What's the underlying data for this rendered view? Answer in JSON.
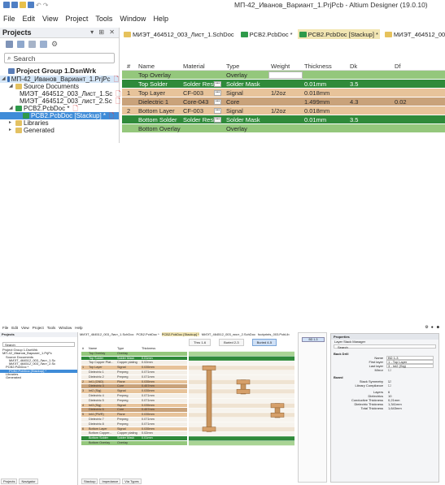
{
  "window": {
    "title": "МП-42_Иванов_Вариант_1.PrjPcb - Altium Designer (19.0.10)"
  },
  "menu": [
    "File",
    "Edit",
    "View",
    "Project",
    "Tools",
    "Window",
    "Help"
  ],
  "projects_panel": {
    "title": "Projects",
    "search_placeholder": "Search",
    "tree": [
      {
        "label": "Project Group 1.DsnWrk",
        "level": 0,
        "kind": "group"
      },
      {
        "label": "МП-42_Иванов_Вариант_1.PrjPc",
        "level": 0,
        "kind": "project",
        "flag": true
      },
      {
        "label": "Source Documents",
        "level": 1,
        "kind": "folder"
      },
      {
        "label": "МИЭТ_464512_003_Лист_1.Sc",
        "level": 2,
        "kind": "sch",
        "flag": true
      },
      {
        "label": "МИЭТ_464512_003_лист_2.Sc",
        "level": 2,
        "kind": "sch",
        "flag": true
      },
      {
        "label": "PCB2.PcbDoc *",
        "level": 1,
        "kind": "pcb",
        "flag": true
      },
      {
        "label": "PCB2.PcbDoc [Stackup] *",
        "level": 2,
        "kind": "pcb-sel",
        "flag": true
      },
      {
        "label": "Libraries",
        "level": 1,
        "kind": "folder"
      },
      {
        "label": "Generated",
        "level": 1,
        "kind": "folder"
      }
    ]
  },
  "doc_tabs": [
    {
      "label": "МИЭТ_464512_003_Лист_1.SchDoc",
      "active": false,
      "color": "#e6c25c"
    },
    {
      "label": "PCB2.PcbDoc *",
      "active": false,
      "color": "#2e9a4a"
    },
    {
      "label": "PCB2.PcbDoc [Stackup] *",
      "active": true,
      "color": "#2e9a4a"
    },
    {
      "label": "МИЭТ_464512_003_лист_2.SchDoc",
      "active": false,
      "color": "#e6c25c"
    },
    {
      "label": "footp",
      "active": false,
      "color": "#8a6c3a"
    }
  ],
  "stackup": {
    "headers": [
      "#",
      "Name",
      "Material",
      "Type",
      "Weight",
      "Thickness",
      "Dk",
      "Df"
    ],
    "rows": [
      {
        "num": "",
        "name": "Top Overlay",
        "material": "",
        "type": "Overlay",
        "weight": "",
        "thickness": "",
        "dk": "",
        "df": "",
        "style": "overlay",
        "combo": false,
        "editing": true
      },
      {
        "num": "",
        "name": "Top Solder",
        "material": "Solder Resist",
        "type": "Solder Mask",
        "weight": "",
        "thickness": "0.01mm",
        "dk": "3.5",
        "df": "",
        "style": "mask",
        "combo": true,
        "editing": false
      },
      {
        "num": "1",
        "name": "Top Layer",
        "material": "CF-003",
        "type": "Signal",
        "weight": "1/2oz",
        "thickness": "0.018mm",
        "dk": "",
        "df": "",
        "style": "copper",
        "combo": true,
        "editing": false
      },
      {
        "num": "",
        "name": "Dielectric 1",
        "material": "Core-043",
        "type": "Core",
        "weight": "",
        "thickness": "1.499mm",
        "dk": "4.3",
        "df": "0.02",
        "style": "core",
        "combo": true,
        "editing": false
      },
      {
        "num": "2",
        "name": "Bottom Layer",
        "material": "CF-003",
        "type": "Signal",
        "weight": "1/2oz",
        "thickness": "0.018mm",
        "dk": "",
        "df": "",
        "style": "copper",
        "combo": true,
        "editing": false
      },
      {
        "num": "",
        "name": "Bottom Solder",
        "material": "Solder Resist",
        "type": "Solder Mask",
        "weight": "",
        "thickness": "0.01mm",
        "dk": "3.5",
        "df": "",
        "style": "mask",
        "combo": true,
        "editing": false
      },
      {
        "num": "",
        "name": "Bottom Overlay",
        "material": "",
        "type": "Overlay",
        "weight": "",
        "thickness": "",
        "dk": "",
        "df": "",
        "style": "overlay",
        "combo": false,
        "editing": false
      }
    ],
    "colors": {
      "overlay": "#94c77c",
      "mask": "#2f8a3a",
      "copper": "#e7c39a",
      "core": "#c9a27a"
    }
  },
  "lower": {
    "menu": [
      "File",
      "Edit",
      "View",
      "Project",
      "Tools",
      "Window",
      "Help"
    ],
    "tabs": [
      "МИЭТ_464512_003_Лист_1.SchDoc",
      "PCB2.PcbDoc *",
      "PCB2.PcbDoc [Stackup] *",
      "МИЭТ_464512_003_лист_2.SchDoc",
      "footprints_003.PcbLib"
    ],
    "projects_title": "Projects",
    "search": "Search",
    "tree": [
      "Project Group 1.DsnWrk",
      "МП-42_Иванов_Вариант_1.PrjPc",
      "Source Documents",
      "МИЭТ_464512_003_Лист_1.Sc",
      "МИЭТ_464512_003_Лист_2.Sc",
      "PCB2.PcbDoc *",
      "PCB2.PcbDoc [Stackup] *",
      "Libraries",
      "Generated"
    ],
    "panel_tabs": [
      "Projects",
      "Navigator"
    ],
    "editor_tabs": [
      "Stackup",
      "Impedance",
      "Via Types"
    ],
    "via_tabs": [
      "Thru 1-6",
      "Buried 2-3",
      "Buried 4-5"
    ],
    "strip_cell": "BD 1-3",
    "table_headers": [
      "#",
      "Name",
      "Type",
      "Thickness"
    ],
    "table_rows": [
      {
        "num": "",
        "name": "Top Overlay",
        "type": "Overlay",
        "thickness": "",
        "style": "overlay"
      },
      {
        "num": "",
        "name": "Top Solder",
        "type": "Solder Mask",
        "thickness": "0.01mm",
        "style": "mask"
      },
      {
        "num": "",
        "name": "Top Copper Plat...",
        "type": "Copper plating",
        "thickness": "0.02mm",
        "style": "plain"
      },
      {
        "num": "1",
        "name": "Top Layer",
        "type": "Signal",
        "thickness": "0.035mm",
        "style": "copper"
      },
      {
        "num": "",
        "name": "Dielectric 1",
        "type": "Prepreg",
        "thickness": "0.071mm",
        "style": "plain"
      },
      {
        "num": "",
        "name": "Dielectric 2",
        "type": "Prepreg",
        "thickness": "0.071mm",
        "style": "plain"
      },
      {
        "num": "2",
        "name": "Int1 (GND)",
        "type": "Plane",
        "thickness": "0.035mm",
        "style": "copper"
      },
      {
        "num": "",
        "name": "Dielectric 3",
        "type": "Core",
        "thickness": "0.457mm",
        "style": "core"
      },
      {
        "num": "3",
        "name": "Int2 (Sig)",
        "type": "Signal",
        "thickness": "0.035mm",
        "style": "copper"
      },
      {
        "num": "",
        "name": "Dielectric 4",
        "type": "Prepreg",
        "thickness": "0.071mm",
        "style": "plain"
      },
      {
        "num": "",
        "name": "Dielectric 5",
        "type": "Prepreg",
        "thickness": "0.071mm",
        "style": "plain"
      },
      {
        "num": "4",
        "name": "Int3 (Sig)",
        "type": "Signal",
        "thickness": "0.035mm",
        "style": "copper"
      },
      {
        "num": "",
        "name": "Dielectric 6",
        "type": "Core",
        "thickness": "0.457mm",
        "style": "core"
      },
      {
        "num": "5",
        "name": "Int4 (PWR)",
        "type": "Plane",
        "thickness": "0.035mm",
        "style": "copper"
      },
      {
        "num": "",
        "name": "Dielectric 7",
        "type": "Prepreg",
        "thickness": "0.071mm",
        "style": "plain"
      },
      {
        "num": "",
        "name": "Dielectric 8",
        "type": "Prepreg",
        "thickness": "0.071mm",
        "style": "plain"
      },
      {
        "num": "6",
        "name": "Bottom Layer",
        "type": "Signal",
        "thickness": "0.035mm",
        "style": "copper"
      },
      {
        "num": "",
        "name": "Bottom Copper...",
        "type": "Copper plating",
        "thickness": "0.02mm",
        "style": "plain"
      },
      {
        "num": "",
        "name": "Bottom Solder",
        "type": "Solder Mask",
        "thickness": "0.01mm",
        "style": "mask"
      },
      {
        "num": "",
        "name": "Bottom Overlay",
        "type": "Overlay",
        "thickness": "",
        "style": "overlay"
      }
    ],
    "properties": {
      "title": "Properties",
      "subtitle": "Layer Stack Manager",
      "search": "Search",
      "back_drill": {
        "heading": "Back Drill",
        "name_label": "Name",
        "name_value": "BD 1-3",
        "first_label": "First layer",
        "first_value": "1 - Top Layer",
        "last_label": "Last layer",
        "last_value": "3 - Int2 (Sig)",
        "mirror_label": "Mirror"
      },
      "board": {
        "heading": "Board",
        "stack_sym_label": "Stack Symmetry",
        "lib_comp_label": "Library Compliance",
        "layers_label": "Layers",
        "layers_value": "6",
        "dielectrics_label": "Dielectrics",
        "dielectrics_value": "10",
        "cond_label": "Conductive Thickness",
        "cond_value": "0,21mm",
        "diel_label": "Dielectric Thickness",
        "diel_value": "1,341mm",
        "total_label": "Total Thickness",
        "total_value": "1,643mm"
      }
    }
  }
}
